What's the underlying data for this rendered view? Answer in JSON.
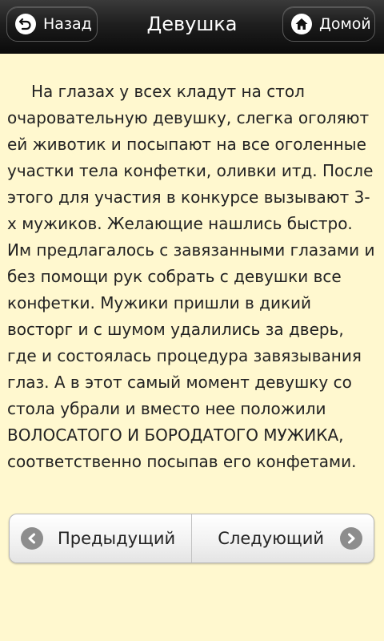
{
  "header": {
    "back_label": "Назад",
    "title": "Девушка",
    "home_label": "Домой",
    "back_icon": "back-arrow-icon",
    "home_icon": "home-icon"
  },
  "article": {
    "text": "На глазах у всех кладут на стол очаровательную девушку, слегка оголяют ей животик и посыпают на все оголенные участки тела конфетки, оливки итд. После этого для участия в конкурсе вызывают 3-х мужиков. Желающие нашлись быстро. Им предлагалось с завязанными глазами и без помощи рук собрать с девушки все конфетки. Мужики пришли в дикий восторг и с шумом удалились за дверь, где и состоялась процедура завязывания глаз. А в этот самый момент девушку со стола убрали и вместо нее положили ВОЛОСАТОГО И БОРОДАТОГО МУЖИКА, соответственно посыпав его конфетами."
  },
  "pager": {
    "prev_label": "Предыдущий",
    "next_label": "Следующий",
    "prev_icon": "chevron-left-icon",
    "next_icon": "chevron-right-icon"
  },
  "colors": {
    "background": "#fff8cf",
    "header": "#1c1c1c",
    "text": "#222222"
  }
}
